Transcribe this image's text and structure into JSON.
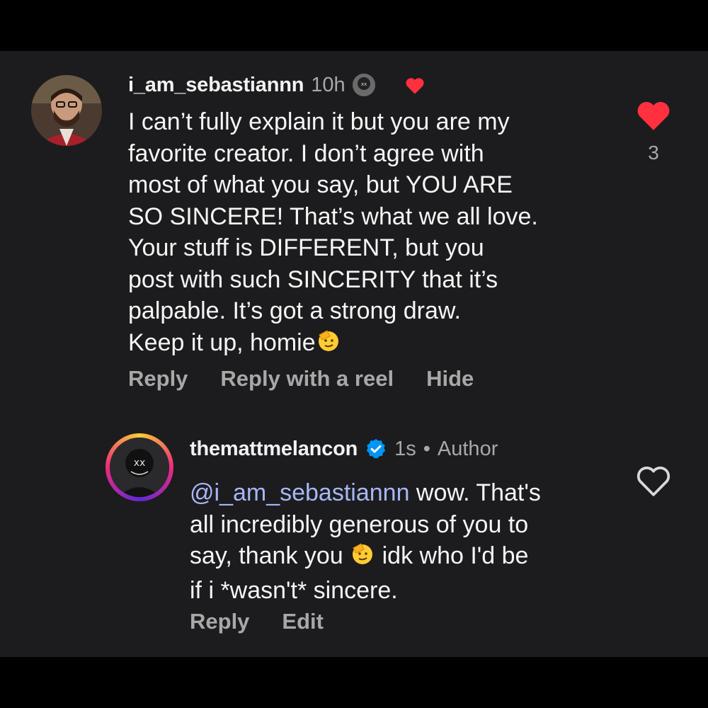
{
  "comment": {
    "username": "i_am_sebastiannn",
    "time": "10h",
    "lines": [
      "I can’t fully explain it but you are my",
      "favorite creator. I don’t agree with",
      "most of what you say, but YOU ARE",
      "SO SINCERE! That’s what we all love.",
      "Your stuff is DIFFERENT, but you",
      "post with such SINCERITY that it’s",
      "palpable. It’s got a strong draw.",
      "Keep it up, homie"
    ],
    "like_count": "3",
    "actions": {
      "reply": "Reply",
      "reply_reel": "Reply with a reel",
      "hide": "Hide"
    },
    "like_icon": "heart-filled-icon",
    "like_color": "#ff3040"
  },
  "reply": {
    "username": "themattmelancon",
    "time": "1s",
    "separator": "•",
    "author_label": "Author",
    "mention": "@i_am_sebastiannn",
    "lines": [
      " wow. That's",
      "all incredibly generous of you to",
      "say, thank you ",
      " idk who I'd be",
      "if i *wasn't* sincere."
    ],
    "actions": {
      "reply": "Reply",
      "edit": "Edit"
    },
    "verified_icon": "verified-badge-icon",
    "verified_color": "#0095f6",
    "like_icon": "heart-outline-icon"
  },
  "emoji": "saluting-face-icon"
}
